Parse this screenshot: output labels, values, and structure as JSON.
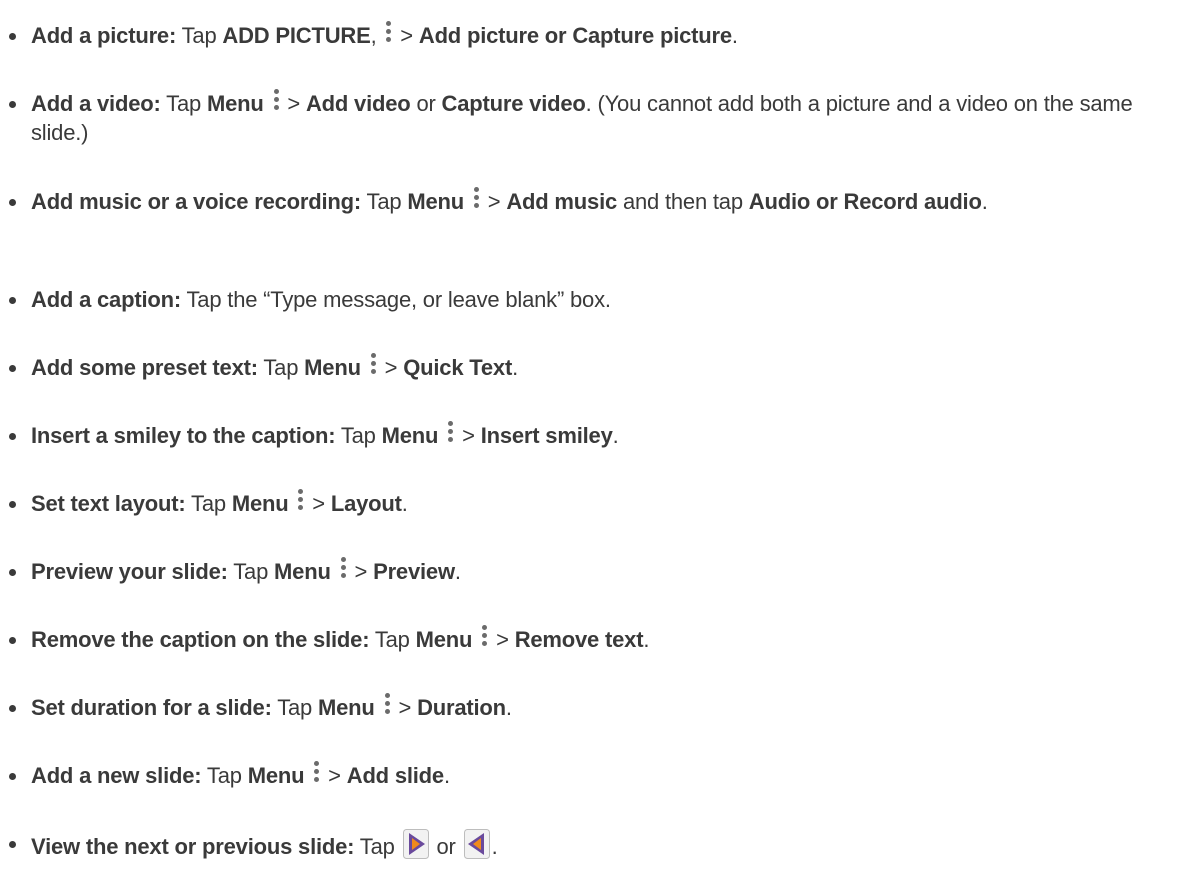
{
  "items": [
    {
      "label": "Add a picture:",
      "tap": " Tap ",
      "b1": "ADD PICTURE",
      "sep": ", ",
      "gt": " > ",
      "b2": "Add picture or Capture picture",
      "end": "."
    },
    {
      "label": "Add a video:",
      "tap": " Tap ",
      "menu": "Menu",
      "gt": " > ",
      "b1": "Add video",
      "or": " or ",
      "b2": "Capture video",
      "end": ". (You cannot add both a picture and a video on the same slide.)"
    },
    {
      "label": "Add music or a voice recording:",
      "tap": " Tap ",
      "menu": "Menu",
      "gt": " > ",
      "b1": "Add music",
      "mid": " and then tap ",
      "b2": "Audio or Record audio",
      "end": "."
    },
    {
      "label": "Add a caption:",
      "text": " Tap the “Type message, or leave blank” box."
    },
    {
      "label": "Add some preset text:",
      "tap": " Tap ",
      "menu": "Menu",
      "gt": " > ",
      "b1": "Quick Text",
      "end": "."
    },
    {
      "label": "Insert a smiley to the caption:",
      "tap": " Tap ",
      "menu": "Menu",
      "gt": " > ",
      "b1": "Insert smiley",
      "end": "."
    },
    {
      "label": "Set text layout:",
      "tap": " Tap ",
      "menu": "Menu",
      "gt": " > ",
      "b1": "Layout",
      "end": "."
    },
    {
      "label": "Preview your slide:",
      "tap": " Tap ",
      "menu": "Menu",
      "gt": " > ",
      "b1": "Preview",
      "end": "."
    },
    {
      "label": "Remove the caption on the slide:",
      "tap": " Tap ",
      "menu": "Menu",
      "gt": " > ",
      "b1": "Remove text",
      "end": "."
    },
    {
      "label": "Set duration for a slide:",
      "tap": " Tap ",
      "menu": "Menu",
      "gt": " > ",
      "b1": "Duration",
      "end": "."
    },
    {
      "label": "Add a new slide:",
      "tap": " Tap ",
      "menu": "Menu",
      "gt": " > ",
      "b1": "Add slide",
      "end": "."
    },
    {
      "label": "View the next or previous slide:",
      "tap": " Tap ",
      "or": " or ",
      "end": "."
    }
  ],
  "icons": {
    "menu": "menu-dots-icon",
    "next": "next-slide-icon",
    "previous": "previous-slide-icon"
  },
  "colors": {
    "text": "#3a3a3a",
    "icon_orange": "#f08a1c",
    "icon_purple": "#6a4a9c"
  }
}
